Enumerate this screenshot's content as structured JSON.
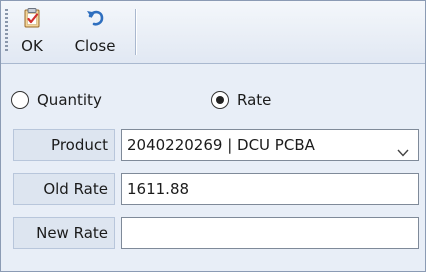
{
  "toolbar": {
    "ok_label": "OK",
    "close_label": "Close",
    "ok_icon": "clipboard-check-icon",
    "close_icon": "undo-arrow-icon"
  },
  "mode": {
    "options": [
      "Quantity",
      "Rate"
    ],
    "selected": "Rate"
  },
  "form": {
    "product_label": "Product",
    "product_value": "2040220269 | DCU PCBA",
    "old_rate_label": "Old Rate",
    "old_rate_value": "1611.88",
    "new_rate_label": "New Rate",
    "new_rate_value": ""
  },
  "colors": {
    "accent": "#2f6fbf",
    "panel": "#e8eef7"
  }
}
